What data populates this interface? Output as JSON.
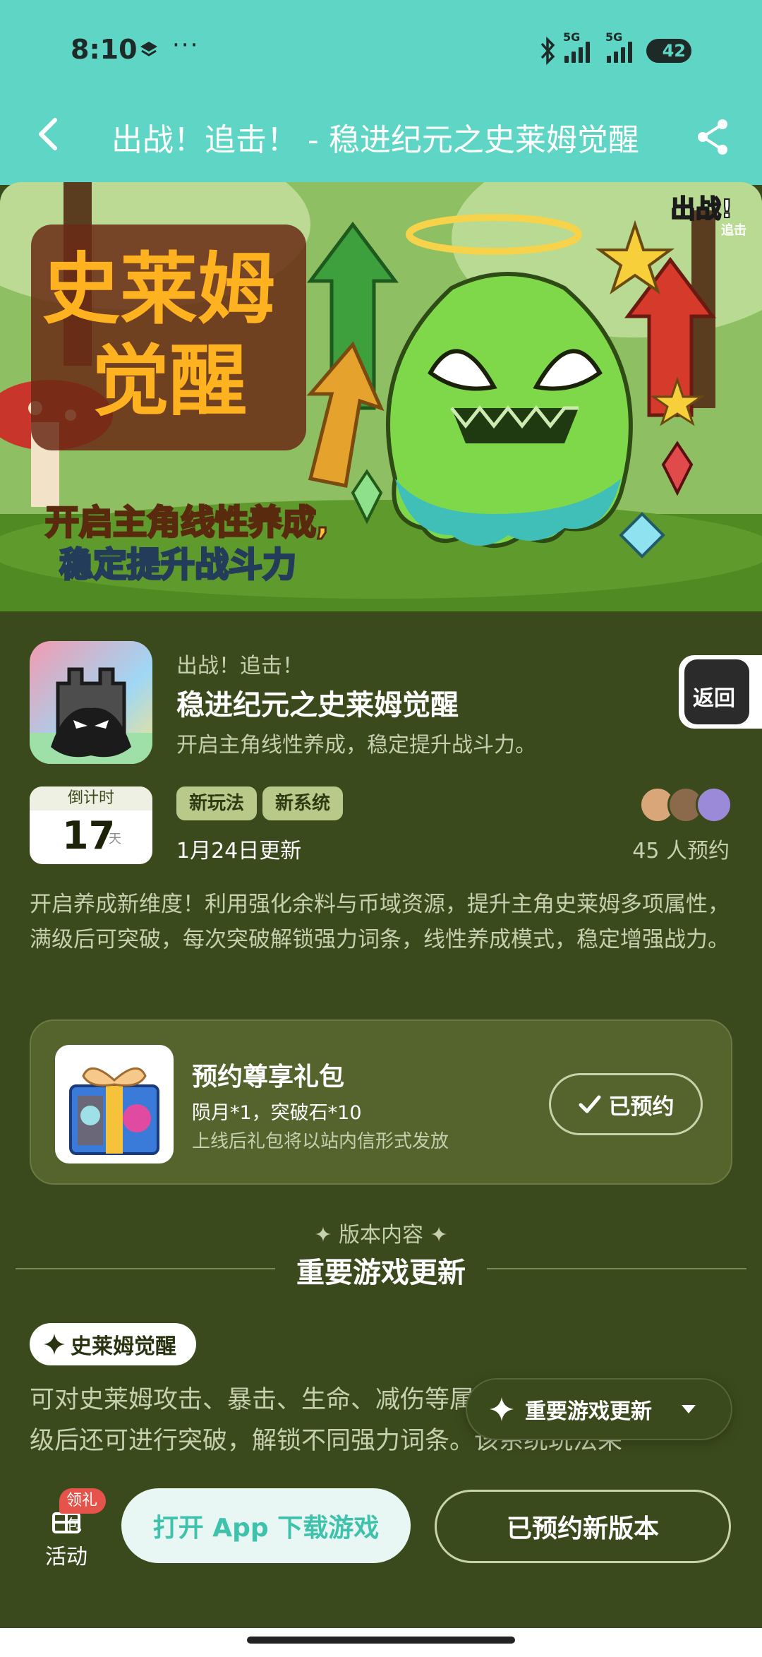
{
  "status_bar": {
    "time": "8:10",
    "signal_label_1": "5G",
    "signal_label_2": "5G",
    "battery": "42"
  },
  "header": {
    "title": "出战！追击！ - 稳进纪元之史莱姆觉醒",
    "back_icon": "chevron-left-icon",
    "share_icon": "share-icon"
  },
  "banner": {
    "headline_line1": "史莱姆",
    "headline_line2": "觉醒",
    "tagline_line1": "开启主角线性养成,",
    "tagline_line2": "稳定提升战斗力",
    "logo_line1": "出战!",
    "logo_line2": "追击"
  },
  "app": {
    "subtitle": "出战！追击！",
    "title": "稳进纪元之史莱姆觉醒",
    "description": "开启主角线性养成，稳定提升战斗力。",
    "return_label": "返回"
  },
  "countdown": {
    "label": "倒计时",
    "days": "17",
    "unit": "天"
  },
  "tags": [
    "新玩法",
    "新系统"
  ],
  "update_date": "1月24日更新",
  "reservations": "45 人预约",
  "long_description": "开启养成新维度！利用强化余料与币域资源，提升主角史莱姆多项属性，满级后可突破，每次突破解锁强力词条，线性养成模式，稳定增强战力。",
  "gift": {
    "title": "预约尊享礼包",
    "items": "陨月*1，突破石*10",
    "note": "上线后礼包将以站内信形式发放",
    "button": "已预约"
  },
  "version": {
    "label": "✦ 版本内容 ✦",
    "section_title": "重要游戏更新",
    "chip": "史莱姆觉醒",
    "body": "可对史莱姆攻击、暴击、生命、减伤等属性进行强化，强化至满级后还可进行突破，解锁不同强力词条。该系统玩法采",
    "float_label": "重要游戏更新"
  },
  "bottom": {
    "badge": "领礼包",
    "activity_label": "活动",
    "open_button": "打开 App 下载游戏",
    "reserved_button": "已预约新版本"
  },
  "colors": {
    "header_bg": "#5fd6c5",
    "page_bg": "#3b4a1c",
    "card_bg": "#55642d",
    "accent_text": "#3fc2ab",
    "badge_red": "#e5534b"
  }
}
